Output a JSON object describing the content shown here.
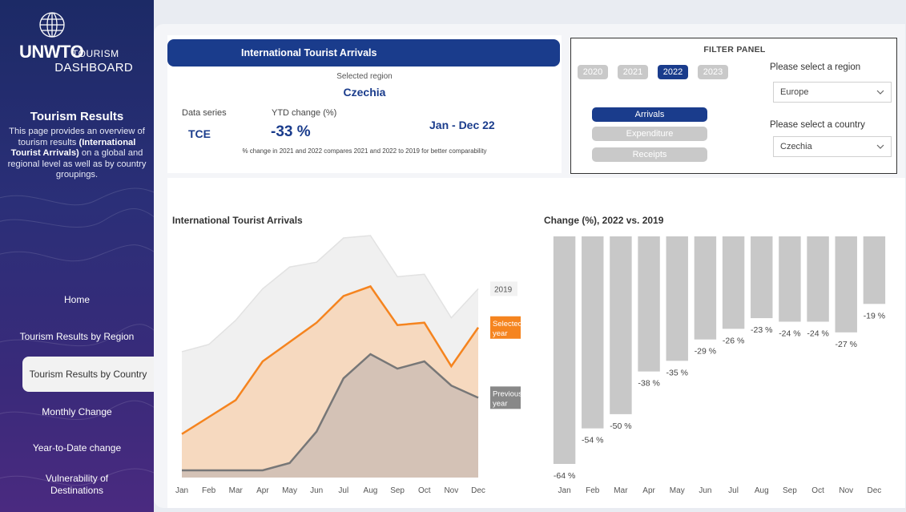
{
  "logo": {
    "brand": "UNWTO",
    "brand_sub": "TOURISM",
    "brand_dash": "DASHBOARD"
  },
  "sidebar": {
    "title": "Tourism Results",
    "description_1": "This page provides an overview of tourism results",
    "description_bold": "(International Tourist Arrivals)",
    "description_2": "on a global and regional level as well as by country groupings.",
    "nav": [
      {
        "label": "Home"
      },
      {
        "label": "Tourism Results by Region"
      },
      {
        "label": "Tourism Results by Country"
      },
      {
        "label": "Monthly Change"
      },
      {
        "label": "Year-to-Date change"
      },
      {
        "label": "Vulnerability of Destinations"
      }
    ],
    "active_index": 2
  },
  "summary": {
    "header": "International Tourist Arrivals",
    "selected_region_label": "Selected region",
    "selected_region": "Czechia",
    "data_series_label": "Data series",
    "data_series": "TCE",
    "ytd_label": "YTD change (%)",
    "ytd_value": "-33 %",
    "period": "Jan - Dec 22",
    "note": "% change in 2021 and 2022 compares 2021 and 2022  to 2019 for better comparability"
  },
  "filter": {
    "title": "FILTER PANEL",
    "years": [
      "2020",
      "2021",
      "2022",
      "2023"
    ],
    "active_year": "2022",
    "series": [
      "Arrivals",
      "Expenditure",
      "Receipts"
    ],
    "active_series": "Arrivals",
    "region_label": "Please select a region",
    "region_value": "Europe",
    "country_label": "Please select a country",
    "country_value": "Czechia"
  },
  "colors": {
    "navy": "#1a3c8c",
    "orange": "#f5841f",
    "orange_fill": "#f6d9bf",
    "gray_fill": "#f0f0f0",
    "prev_fill": "#d4c2b6",
    "prev_line": "#777777",
    "bar": "#c8c8c8"
  },
  "chart_data": [
    {
      "type": "area",
      "title": "International Tourist Arrivals",
      "categories": [
        "Jan",
        "Feb",
        "Mar",
        "Apr",
        "May",
        "Jun",
        "Jul",
        "Aug",
        "Sep",
        "Oct",
        "Nov",
        "Dec"
      ],
      "ylim": [
        0,
        100
      ],
      "series": [
        {
          "name": "2019",
          "values": [
            52,
            55,
            65,
            78,
            87,
            89,
            99,
            100,
            83,
            84,
            66,
            78
          ]
        },
        {
          "name": "Selected year",
          "values": [
            18,
            25,
            32,
            48,
            56,
            64,
            75,
            79,
            63,
            64,
            46,
            62
          ]
        },
        {
          "name": "Previous year",
          "values": [
            3,
            3,
            3,
            3,
            6,
            19,
            41,
            51,
            45,
            48,
            38,
            33
          ]
        }
      ],
      "legend_labels": [
        "2019",
        "Selected year",
        "Previous year"
      ]
    },
    {
      "type": "bar",
      "title": "Change (%), 2022 vs. 2019",
      "categories": [
        "Jan",
        "Feb",
        "Mar",
        "Apr",
        "May",
        "Jun",
        "Jul",
        "Aug",
        "Sep",
        "Oct",
        "Nov",
        "Dec"
      ],
      "values": [
        -64,
        -54,
        -50,
        -38,
        -35,
        -29,
        -26,
        -23,
        -24,
        -24,
        -27,
        -19
      ],
      "labels": [
        "-64 %",
        "-54 %",
        "-50 %",
        "-38 %",
        "-35 %",
        "-29 %",
        "-26 %",
        "-23 %",
        "-24 %",
        "-24 %",
        "-27 %",
        "-19 %"
      ],
      "ylim": [
        -64,
        0
      ]
    }
  ]
}
